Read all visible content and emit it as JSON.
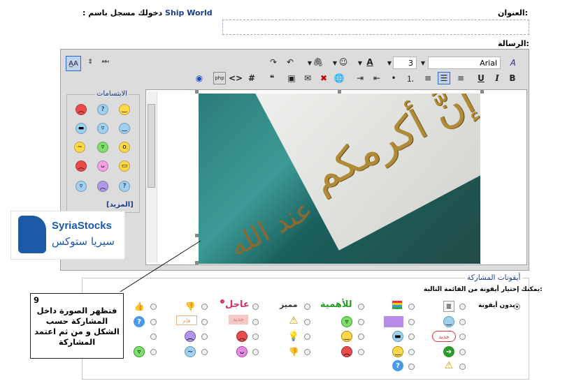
{
  "header": {
    "title_label": "العنوان:",
    "logged_in_label": "دخولك مسجل باسم :",
    "username": "Ship World",
    "message_label": "الرسالة:"
  },
  "toolbar": {
    "font_name": "Arial",
    "font_size": "3"
  },
  "smilies": {
    "legend": "الابتسامات",
    "more_link": "[المزيد]"
  },
  "post_icons": {
    "legend": "أيقونات المشاركة",
    "instruction": "يمكنك إختيار أيقونة من القائمة التالية:",
    "no_icon_label": "بدون أيقونة",
    "text_icons": [
      "للأهمية",
      "مميز",
      "عاجل",
      "جديد",
      "جديد",
      "هام"
    ]
  },
  "logo": {
    "latin": "SyriaStocks",
    "arabic": "سيريا ستوكس"
  },
  "annotation": {
    "number": "9",
    "text": "فتظهر الصورة داخل المشاركة حسب الشكل و من ثم اعتمد المشاركة"
  },
  "colors": {
    "accent": "#316ac5",
    "link": "#1a3c8a",
    "logo_blue": "#1c5aa8"
  }
}
